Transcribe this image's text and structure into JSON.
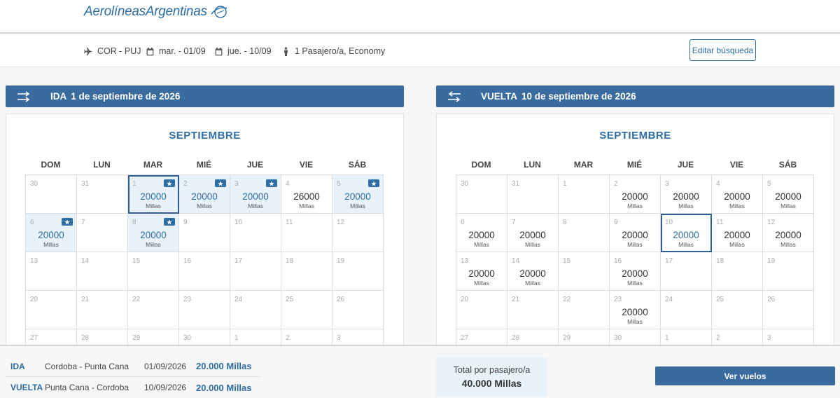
{
  "brand": {
    "name": "AerolíneasArgentinas"
  },
  "search": {
    "route": "COR - PUJ",
    "depart_date": "mar. - 01/09",
    "return_date": "jue. - 10/09",
    "passengers": "1 Pasajero/a, Economy",
    "edit_label": "Editar búsqueda"
  },
  "weekdays": [
    "DOM",
    "LUN",
    "MAR",
    "MIÉ",
    "JUE",
    "VIE",
    "SÁB"
  ],
  "outbound": {
    "label": "IDA",
    "date_text": "1 de septiembre de 2026",
    "month": "SEPTIEMBRE",
    "cells": [
      {
        "day": "30"
      },
      {
        "day": "31"
      },
      {
        "day": "1",
        "price": "20000",
        "unit": "Millas",
        "badge": true,
        "avail": true,
        "selected": true
      },
      {
        "day": "2",
        "price": "20000",
        "unit": "Millas",
        "badge": true,
        "avail": true
      },
      {
        "day": "3",
        "price": "20000",
        "unit": "Millas",
        "badge": true,
        "avail": true
      },
      {
        "day": "4",
        "price": "26000",
        "unit": "Millas"
      },
      {
        "day": "5",
        "price": "20000",
        "unit": "Millas",
        "badge": true,
        "avail": true
      },
      {
        "day": "6",
        "price": "20000",
        "unit": "Millas",
        "badge": true,
        "avail": true
      },
      {
        "day": "7"
      },
      {
        "day": "8",
        "price": "20000",
        "unit": "Millas",
        "badge": true,
        "avail": true
      },
      {
        "day": "9"
      },
      {
        "day": "10"
      },
      {
        "day": "11"
      },
      {
        "day": "12"
      },
      {
        "day": "13"
      },
      {
        "day": "14"
      },
      {
        "day": "15"
      },
      {
        "day": "16"
      },
      {
        "day": "17"
      },
      {
        "day": "18"
      },
      {
        "day": "19"
      },
      {
        "day": "20"
      },
      {
        "day": "21"
      },
      {
        "day": "22"
      },
      {
        "day": "23"
      },
      {
        "day": "24"
      },
      {
        "day": "25"
      },
      {
        "day": "26"
      },
      {
        "day": "27"
      },
      {
        "day": "28"
      },
      {
        "day": "29"
      },
      {
        "day": "30"
      },
      {
        "day": "1"
      },
      {
        "day": "2"
      },
      {
        "day": "3"
      }
    ]
  },
  "return": {
    "label": "VUELTA",
    "date_text": "10 de septiembre de 2026",
    "month": "SEPTIEMBRE",
    "cells": [
      {
        "day": "30"
      },
      {
        "day": "31"
      },
      {
        "day": "1"
      },
      {
        "day": "2",
        "price": "20000",
        "unit": "Millas"
      },
      {
        "day": "3",
        "price": "20000",
        "unit": "Millas"
      },
      {
        "day": "4",
        "price": "20000",
        "unit": "Millas"
      },
      {
        "day": "5",
        "price": "20000",
        "unit": "Millas"
      },
      {
        "day": "6",
        "price": "20000",
        "unit": "Millas"
      },
      {
        "day": "7",
        "price": "20000",
        "unit": "Millas"
      },
      {
        "day": "8"
      },
      {
        "day": "9",
        "price": "20000",
        "unit": "Millas"
      },
      {
        "day": "10",
        "price": "20000",
        "unit": "Millas",
        "selected": true,
        "blue": true
      },
      {
        "day": "11",
        "price": "20000",
        "unit": "Millas"
      },
      {
        "day": "12",
        "price": "20000",
        "unit": "Millas"
      },
      {
        "day": "13",
        "price": "20000",
        "unit": "Millas"
      },
      {
        "day": "14",
        "price": "20000",
        "unit": "Millas"
      },
      {
        "day": "15"
      },
      {
        "day": "16",
        "price": "20000",
        "unit": "Millas"
      },
      {
        "day": "17"
      },
      {
        "day": "18"
      },
      {
        "day": "19"
      },
      {
        "day": "20"
      },
      {
        "day": "21"
      },
      {
        "day": "22"
      },
      {
        "day": "23",
        "price": "20000",
        "unit": "Millas"
      },
      {
        "day": "24"
      },
      {
        "day": "25"
      },
      {
        "day": "26"
      },
      {
        "day": "27"
      },
      {
        "day": "28"
      },
      {
        "day": "29"
      },
      {
        "day": "30"
      },
      {
        "day": "1"
      },
      {
        "day": "2"
      },
      {
        "day": "3"
      }
    ]
  },
  "summary": {
    "legs": [
      {
        "dir": "IDA",
        "route": "Cordoba - Punta Cana",
        "date": "01/09/2026",
        "miles": "20.000 Millas"
      },
      {
        "dir": "VUELTA",
        "route": "Punta Cana - Cordoba",
        "date": "10/09/2026",
        "miles": "20.000 Millas"
      }
    ],
    "total_label": "Total por pasajero/a",
    "total_value": "40.000 Millas",
    "view_label": "Ver vuelos"
  },
  "colors": {
    "brand": "#2e6da4",
    "header": "#3a6b9e",
    "available": "#e8f2fb"
  }
}
